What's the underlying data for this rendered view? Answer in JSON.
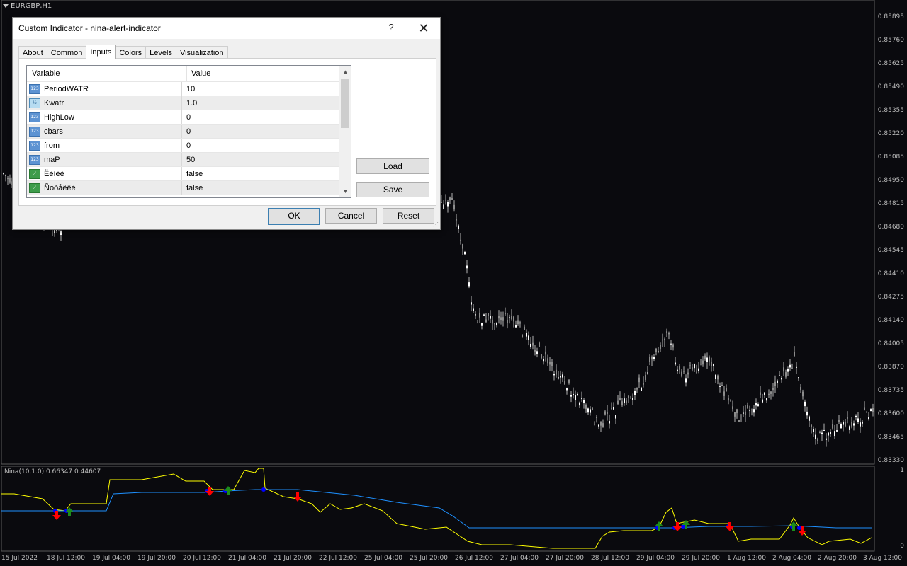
{
  "chart": {
    "symbol": "EURGBP,H1",
    "indicator_label": "Nina(10,1.0) 0.66347 0.44607",
    "price_labels": [
      "0.85895",
      "0.85760",
      "0.85625",
      "0.85490",
      "0.85355",
      "0.85220",
      "0.85085",
      "0.84950",
      "0.84815",
      "0.84680",
      "0.84545",
      "0.84410",
      "0.84275",
      "0.84140",
      "0.84005",
      "0.83870",
      "0.83735",
      "0.83600",
      "0.83465",
      "0.83330"
    ],
    "indicator_scale": [
      "1",
      "0"
    ],
    "time_labels": [
      "15 Jul 2022",
      "18 Jul 12:00",
      "19 Jul 04:00",
      "19 Jul 20:00",
      "20 Jul 12:00",
      "21 Jul 04:00",
      "21 Jul 20:00",
      "22 Jul 12:00",
      "25 Jul 04:00",
      "25 Jul 20:00",
      "26 Jul 12:00",
      "27 Jul 04:00",
      "27 Jul 20:00",
      "28 Jul 12:00",
      "29 Jul 04:00",
      "29 Jul 20:00",
      "1 Aug 12:00",
      "2 Aug 04:00",
      "2 Aug 20:00",
      "3 Aug 12:00"
    ],
    "colors": {
      "background": "#0a0a0e",
      "candle": "#b4b4b4",
      "yellow_line": "#ffff00",
      "blue_line": "#1e90ff",
      "up_arrow": "#1c8c1c",
      "down_arrow": "#ff0000",
      "dot": "#0000ff"
    }
  },
  "dialog": {
    "title": "Custom Indicator - nina-alert-indicator",
    "help_icon": "?",
    "close_icon": "✕",
    "tabs": [
      {
        "label": "About"
      },
      {
        "label": "Common"
      },
      {
        "label": "Inputs",
        "active": true
      },
      {
        "label": "Colors"
      },
      {
        "label": "Levels"
      },
      {
        "label": "Visualization"
      }
    ],
    "grid": {
      "col_variable": "Variable",
      "col_value": "Value",
      "rows": [
        {
          "icon": "integer-icon",
          "name": "PeriodWATR",
          "value": "10"
        },
        {
          "icon": "double-icon",
          "name": "Kwatr",
          "value": "1.0"
        },
        {
          "icon": "integer-icon",
          "name": "HighLow",
          "value": "0"
        },
        {
          "icon": "integer-icon",
          "name": "cbars",
          "value": "0"
        },
        {
          "icon": "integer-icon",
          "name": "from",
          "value": "0"
        },
        {
          "icon": "integer-icon",
          "name": "maP",
          "value": "50"
        },
        {
          "icon": "bool-icon",
          "name": "Ëèíèè",
          "value": "false"
        },
        {
          "icon": "bool-icon",
          "name": "Ñòðåëêè",
          "value": "false"
        }
      ]
    },
    "buttons": {
      "load": "Load",
      "save": "Save",
      "ok": "OK",
      "cancel": "Cancel",
      "reset": "Reset"
    }
  }
}
